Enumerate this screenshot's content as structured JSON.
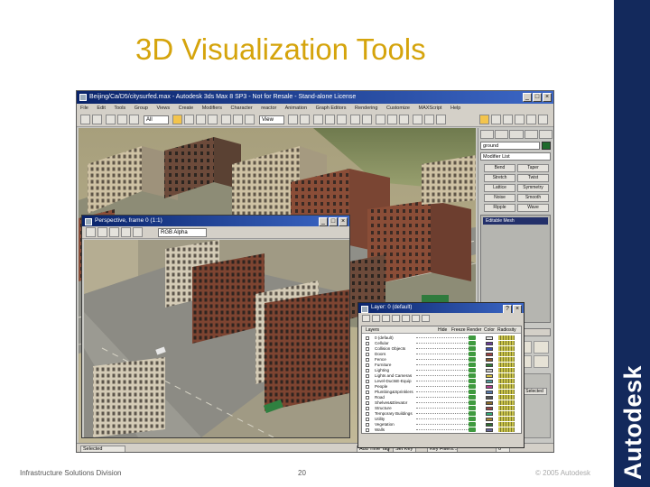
{
  "slide": {
    "title": "3D Visualization Tools",
    "footer_left": "Infrastructure Solutions Division",
    "page_number": "20",
    "copyright": "© 2005 Autodesk",
    "brand": "Autodesk",
    "colors": {
      "title": "#d5a40c",
      "band": "#13295c"
    }
  },
  "main_window": {
    "title": "Beijing/Ca/D5/citysurfed.max - Autodesk 3ds Max 8 SP3 - Not for Resale - Stand-alone License",
    "menu": [
      "File",
      "Edit",
      "Tools",
      "Group",
      "Views",
      "Create",
      "Modifiers",
      "Character",
      "reactor",
      "Animation",
      "Graph Editors",
      "Rendering",
      "Customize",
      "MAXScript",
      "Help"
    ],
    "toolbar": {
      "selection_filter": "All",
      "coord_system": "View"
    },
    "command_panel": {
      "object_name": "ground",
      "modifier_list": "Modifier List",
      "modifier_buttons": [
        "Bend",
        "Taper",
        "Stretch",
        "Twist",
        "Lattice",
        "Symmetry",
        "Noise",
        "Smooth",
        "Ripple",
        "Wave"
      ],
      "stack_item": "Editable Mesh",
      "rollout": "Selection",
      "selected_label": "Selected"
    },
    "status": {
      "prompt": "Selected",
      "add_time_tag": "Add Time Tag",
      "set_key": "Set Key",
      "key_filters": "Key Filters...",
      "frame": "0"
    }
  },
  "perspective_window": {
    "title": "Perspective, frame 0 (1:1)",
    "view_dropdown": "RGB Alpha"
  },
  "layer_dialog": {
    "title": "Layer: 0 (default)",
    "columns": [
      "Layers",
      "Hide",
      "Freeze",
      "Render",
      "Color",
      "Radiosity"
    ],
    "layers": [
      "0 (default)",
      "Cellular",
      "Collision Objects",
      "Doors",
      "Fence",
      "Furniture",
      "Lighting",
      "Lights and Cameras",
      "Level-DuctsE-Equip",
      "People",
      "Plumbing&Sprinklers",
      "Road",
      "Shelves&Elevator",
      "Structure",
      "Temporary Buildings",
      "Utility",
      "Vegetation",
      "Walls"
    ],
    "layer_colors": [
      "#e8e8e8",
      "#6a3b99",
      "#3d4fae",
      "#a04040",
      "#8b5a2b",
      "#2e7d32",
      "#c7c7c7",
      "#d4c040",
      "#4f9b9b",
      "#b23f8c",
      "#5577aa",
      "#555555",
      "#8a6a2a",
      "#994444",
      "#33aa77",
      "#aa8833",
      "#2f6f2f",
      "#666699"
    ]
  }
}
